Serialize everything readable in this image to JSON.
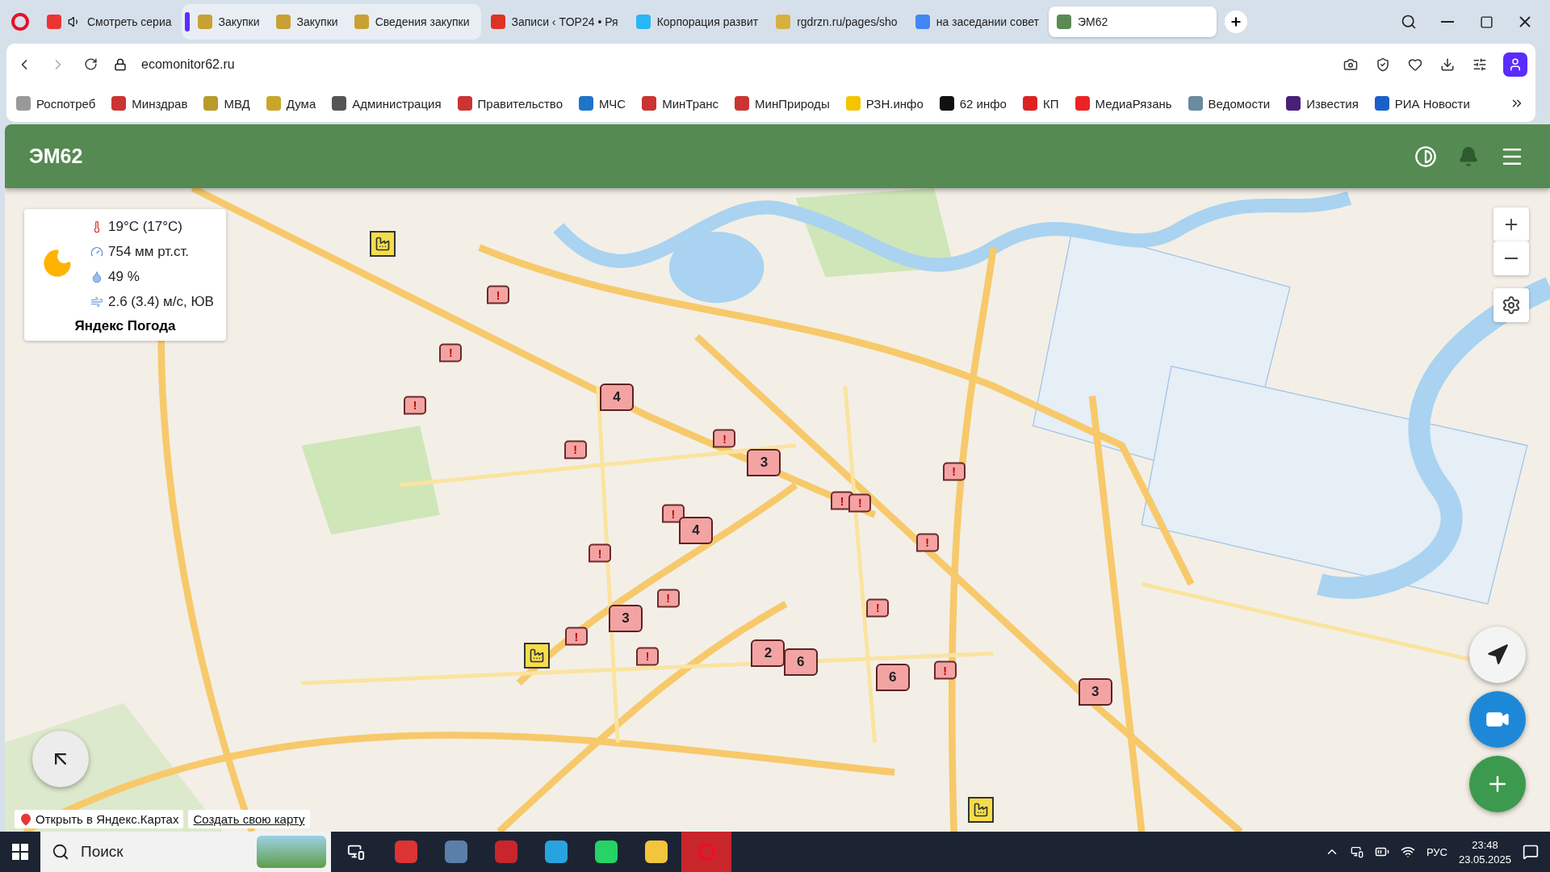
{
  "browser": {
    "tabs": [
      {
        "title": "Смотреть сериа",
        "kind": "media",
        "selected": false
      },
      {
        "title": "Закупки",
        "kind": "grouped",
        "selected": false
      },
      {
        "title": "Закупки",
        "kind": "grouped",
        "selected": false
      },
      {
        "title": "Сведения закупки",
        "kind": "grouped",
        "selected": false
      },
      {
        "title": "Записи ‹ TOP24 • Ря",
        "kind": "single",
        "selected": false
      },
      {
        "title": "Корпорация развит",
        "kind": "single",
        "selected": false
      },
      {
        "title": "rgdrzn.ru/pages/sho",
        "kind": "single",
        "selected": false
      },
      {
        "title": "на заседании совет",
        "kind": "single",
        "selected": false
      },
      {
        "title": "ЭМ62",
        "kind": "single",
        "selected": true
      }
    ],
    "address": "ecomonitor62.ru",
    "bookmarks": [
      "Роспотреб",
      "Минздрав",
      "МВД",
      "Дума",
      "Администрация",
      "Правительство",
      "МЧС",
      "МинТранс",
      "МинПрироды",
      "РЗН.инфо",
      "62 инфо",
      "КП",
      "МедиаРязань",
      "Ведомости",
      "Известия",
      "РИА Новости"
    ]
  },
  "app": {
    "title": "ЭМ62"
  },
  "weather": {
    "temperature": "19°C (17°C)",
    "pressure": "754 мм рт.ст.",
    "humidity": "49 %",
    "wind": "2.6 (3.4) м/с, ЮВ",
    "source": "Яндекс Погода"
  },
  "markers": [
    {
      "kind": "alert",
      "label": "!"
    },
    {
      "kind": "alert",
      "label": "!"
    },
    {
      "kind": "alert",
      "label": "!"
    },
    {
      "kind": "alert",
      "label": "!"
    },
    {
      "kind": "alert",
      "label": "!"
    },
    {
      "kind": "alert",
      "label": "!"
    },
    {
      "kind": "alert",
      "label": "!"
    },
    {
      "kind": "alert",
      "label": "!"
    },
    {
      "kind": "alert",
      "label": "!"
    },
    {
      "kind": "alert",
      "label": "!"
    },
    {
      "kind": "alert",
      "label": "!"
    },
    {
      "kind": "alert",
      "label": "!"
    },
    {
      "kind": "alert",
      "label": "!"
    },
    {
      "kind": "alert",
      "label": "!"
    },
    {
      "kind": "alert",
      "label": "!"
    },
    {
      "kind": "alert",
      "label": "!"
    },
    {
      "kind": "cluster",
      "label": "4"
    },
    {
      "kind": "cluster",
      "label": "3"
    },
    {
      "kind": "cluster",
      "label": "4"
    },
    {
      "kind": "cluster",
      "label": "3"
    },
    {
      "kind": "cluster",
      "label": "2"
    },
    {
      "kind": "cluster",
      "label": "6"
    },
    {
      "kind": "cluster",
      "label": "6"
    },
    {
      "kind": "cluster",
      "label": "3"
    },
    {
      "kind": "factory"
    },
    {
      "kind": "factory"
    },
    {
      "kind": "factory"
    }
  ],
  "map_links": [
    "Открыть в Яндекс.Картах",
    "Создать свою карту"
  ],
  "taskbar": {
    "search_placeholder": "Поиск",
    "language": "РУС",
    "time": "23:48",
    "date": "23.05.2025"
  }
}
